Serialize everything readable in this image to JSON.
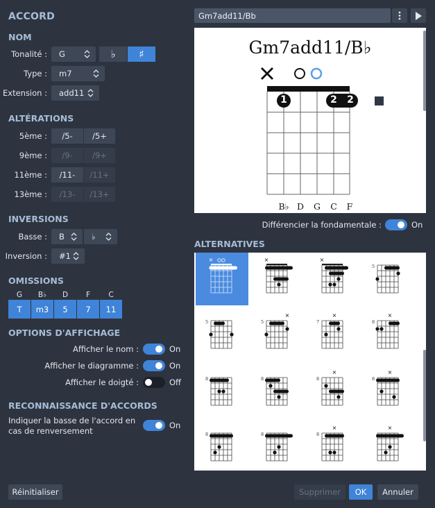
{
  "title": "ACCORD",
  "chord_name_field": "Gm7add11/Bb",
  "nom": {
    "heading": "NOM",
    "tonalite_label": "Tonalité :",
    "tonalite_value": "G",
    "flat_label": "♭",
    "sharp_label": "♯",
    "type_label": "Type :",
    "type_value": "m7",
    "extension_label": "Extension :",
    "extension_value": "add11"
  },
  "alterations": {
    "heading": "ALTÉRATIONS",
    "rows": [
      {
        "label": "5ème :",
        "a": "/5-",
        "b": "/5+",
        "a_enabled": true,
        "b_enabled": true
      },
      {
        "label": "9ème :",
        "a": "/9-",
        "b": "/9+",
        "a_enabled": false,
        "b_enabled": false
      },
      {
        "label": "11ème :",
        "a": "/11-",
        "b": "/11+",
        "a_enabled": true,
        "b_enabled": false
      },
      {
        "label": "13ème :",
        "a": "/13-",
        "b": "/13+",
        "a_enabled": false,
        "b_enabled": false
      }
    ]
  },
  "inversions": {
    "heading": "INVERSIONS",
    "basse_label": "Basse :",
    "basse_value": "B",
    "basse_accidental": "♭",
    "inversion_label": "Inversion :",
    "inversion_value": "#1"
  },
  "omissions": {
    "heading": "OMISSIONS",
    "notes": [
      "G",
      "B♭",
      "D",
      "F",
      "C"
    ],
    "buttons": [
      "T",
      "m3",
      "5",
      "7",
      "11"
    ]
  },
  "options": {
    "heading": "OPTIONS D'AFFICHAGE",
    "show_name_label": "Afficher le nom :",
    "show_name_state": "On",
    "show_diagram_label": "Afficher le diagramme :",
    "show_diagram_state": "On",
    "show_fingering_label": "Afficher le doigté :",
    "show_fingering_state": "Off"
  },
  "recognition": {
    "heading": "RECONNAISSANCE D'ACCORDS",
    "bass_label": "Indiquer la basse de l'accord en cas de renversement",
    "bass_state": "On"
  },
  "diagram": {
    "chord_title": "Gm7add11/B♭",
    "string_labels": [
      "B♭",
      "D",
      "G",
      "C",
      "F"
    ],
    "finger_labels": [
      "1",
      "2",
      "2"
    ]
  },
  "differencier": {
    "label": "Différencier la fondamentale :",
    "state": "On"
  },
  "alternatives": {
    "heading": "ALTERNATIVES",
    "fret_labels": [
      "5",
      "5",
      "5",
      "7",
      "8",
      "8",
      "8",
      "8",
      "8",
      "8",
      "8",
      "8"
    ]
  },
  "footer": {
    "reset": "Réinitialiser",
    "delete": "Supprimer",
    "ok": "OK",
    "cancel": "Annuler"
  },
  "colors": {
    "bg": "#2d3440",
    "accent": "#3f84d8",
    "heading": "#a8bcd6"
  }
}
